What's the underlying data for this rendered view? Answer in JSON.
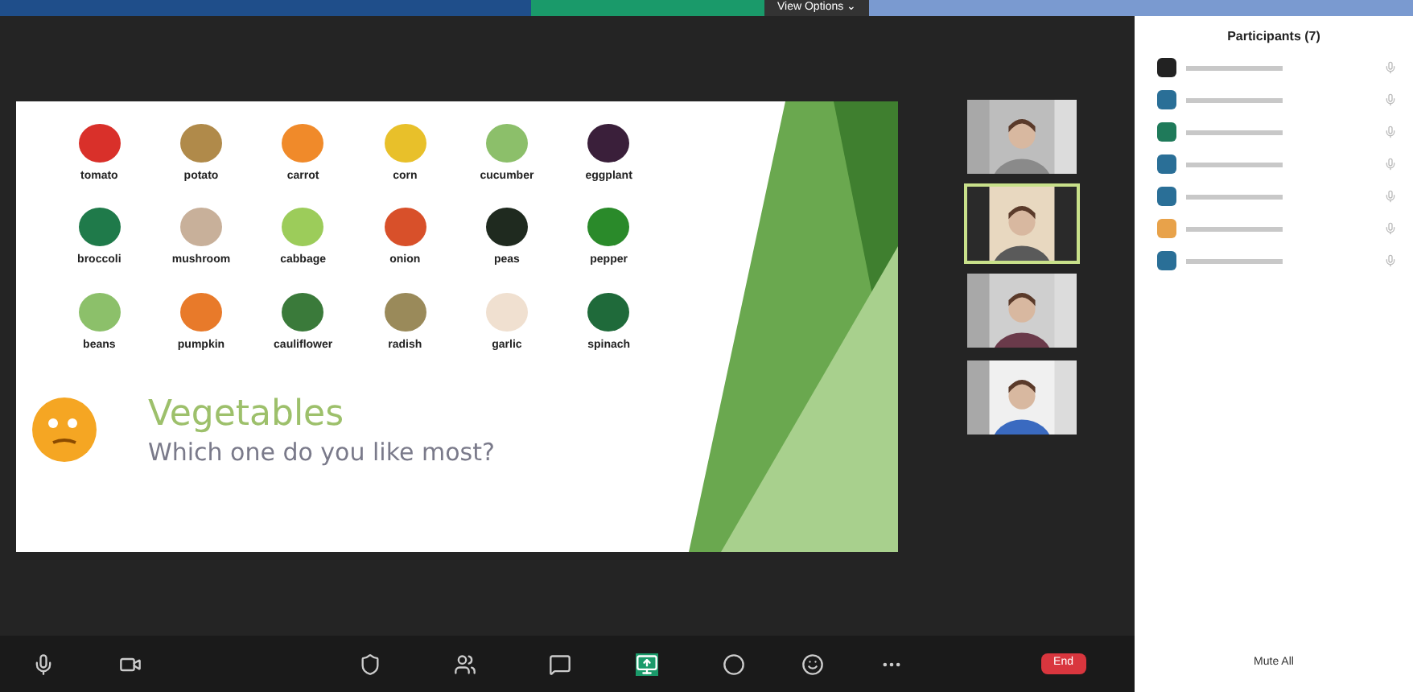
{
  "title_bar": {
    "view_options": "View Options ⌄"
  },
  "slide": {
    "vegetables": [
      {
        "name": "tomato",
        "color": "#d9302a"
      },
      {
        "name": "potato",
        "color": "#b08a4a"
      },
      {
        "name": "carrot",
        "color": "#f08a2a"
      },
      {
        "name": "corn",
        "color": "#e8c02a"
      },
      {
        "name": "cucumber",
        "color": "#8cbf6a"
      },
      {
        "name": "eggplant",
        "color": "#3a1f3a"
      },
      {
        "name": "broccoli",
        "color": "#1f7a4a"
      },
      {
        "name": "mushroom",
        "color": "#c8b09a"
      },
      {
        "name": "cabbage",
        "color": "#9ccc5a"
      },
      {
        "name": "onion",
        "color": "#d8502a"
      },
      {
        "name": "peas",
        "color": "#1f2a1f"
      },
      {
        "name": "pepper",
        "color": "#2a8a2a"
      },
      {
        "name": "beans",
        "color": "#8cc06a"
      },
      {
        "name": "pumpkin",
        "color": "#e87a2a"
      },
      {
        "name": "cauliflower",
        "color": "#3a7a3a"
      },
      {
        "name": "radish",
        "color": "#9a8a5a"
      },
      {
        "name": "garlic",
        "color": "#f0e0d0"
      },
      {
        "name": "spinach",
        "color": "#1f6a3a"
      }
    ],
    "title": "Vegetables",
    "subtitle": "Which one do you like most?"
  },
  "video_tiles": [
    {
      "kind": "video",
      "selected": false
    },
    {
      "kind": "video",
      "selected": true
    },
    {
      "kind": "video",
      "selected": false
    },
    {
      "kind": "video",
      "selected": false
    }
  ],
  "participants": {
    "title": "Participants (7)",
    "people": [
      {
        "color": "#222222"
      },
      {
        "color": "#2a6f97"
      },
      {
        "color": "#1f7a5a"
      },
      {
        "color": "#2a6f97"
      },
      {
        "color": "#2a6f97"
      },
      {
        "color": "#e8a24a"
      },
      {
        "color": "#2a6f97"
      }
    ],
    "mute_all": "Mute All"
  },
  "toolbar": {
    "end": "End"
  }
}
